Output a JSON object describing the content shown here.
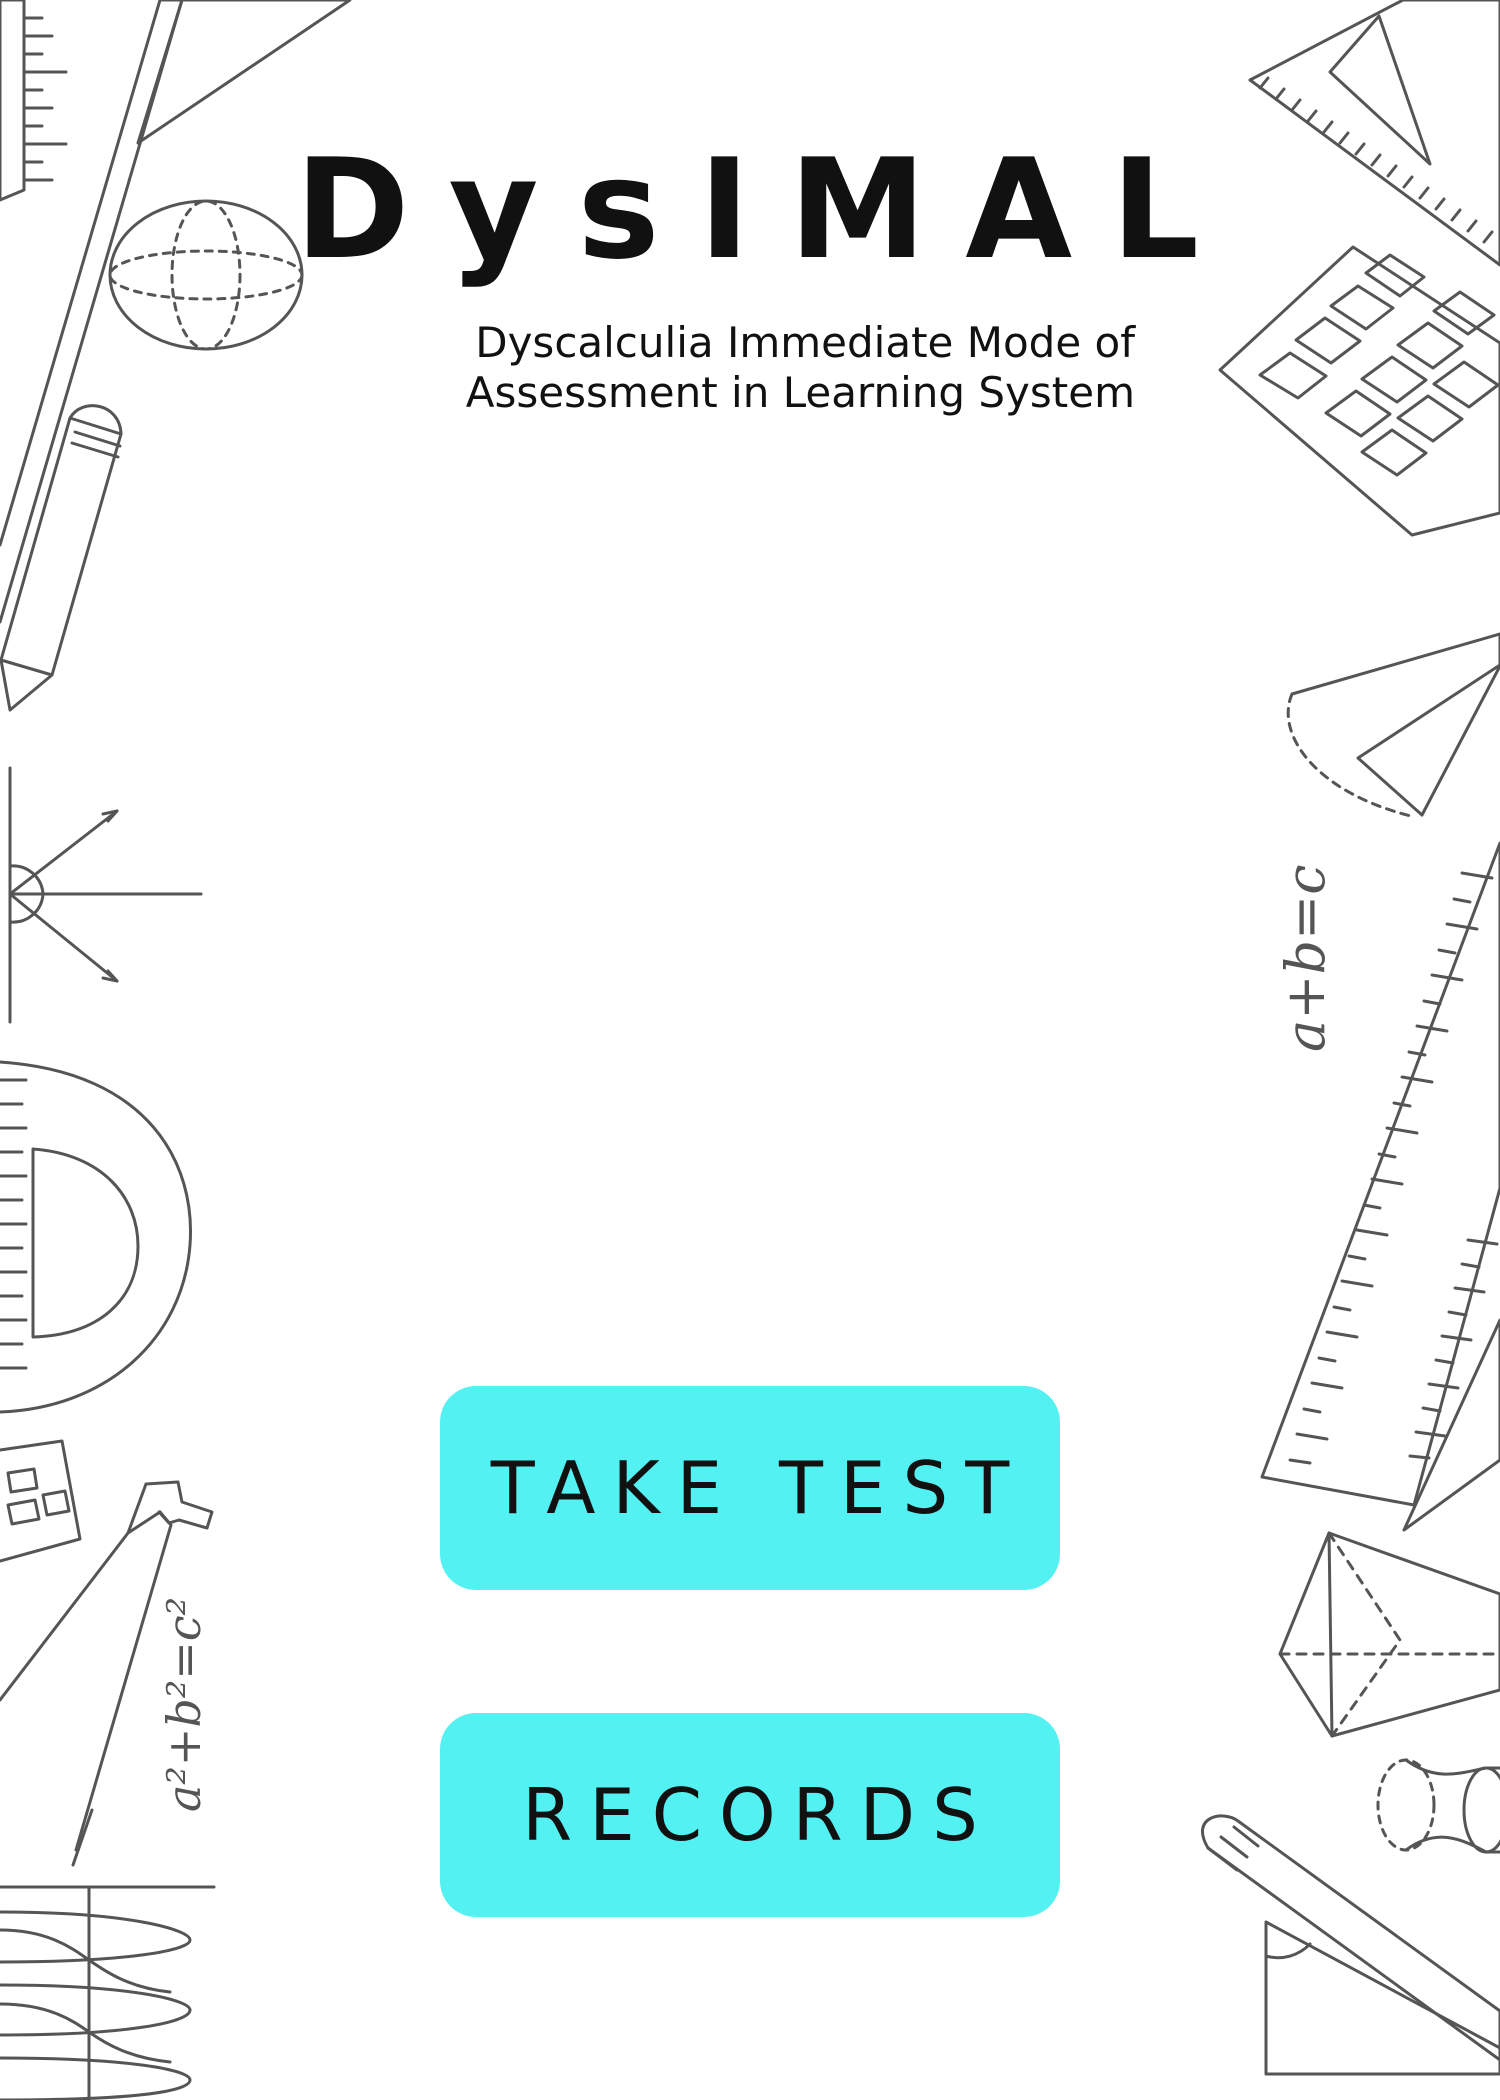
{
  "app": {
    "title": "DysIMAL",
    "subtitle_lines": [
      "Dyscalculia Immediate Mode of",
      "Assessment in Learning System"
    ]
  },
  "actions": {
    "take_test_label": "TAKE TEST",
    "records_label": "RECORDS"
  },
  "decorations": {
    "formula_right": "a+b=c",
    "formula_left": "a²+b²=c²"
  },
  "colors": {
    "background": "#ffffff",
    "text": "#111111",
    "button": "#53f1f1",
    "line_art": "#555555"
  }
}
